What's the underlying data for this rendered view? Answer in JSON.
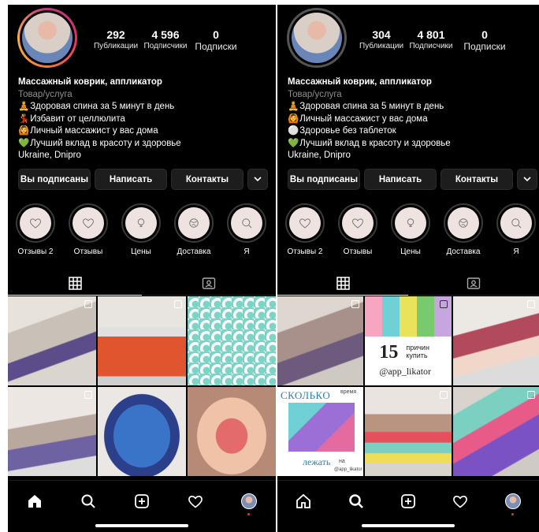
{
  "screens": [
    {
      "stats": [
        {
          "value": "292",
          "label": "Публикации"
        },
        {
          "value": "4 596",
          "label": "Подписчики"
        },
        {
          "value": "0",
          "label": "Подписки"
        }
      ],
      "bio": {
        "name": "Массажный коврик, аппликатор",
        "category": "Товар/услуга",
        "lines": [
          {
            "emoji": "🧘",
            "text": "Здоровая спина за 5 минут в день"
          },
          {
            "emoji": "💃",
            "text": "Избавит от целлюлита"
          },
          {
            "emoji": "🙆",
            "text": "Личный массажист у вас дома"
          },
          {
            "emoji": "💚",
            "text": "Лучший вклад в красоту и здоровье"
          }
        ],
        "location": "Ukraine, Dnipro"
      },
      "buttons": {
        "following": "Вы подписаны",
        "message": "Написать",
        "contacts": "Контакты"
      },
      "highlights": [
        "Отзывы 2",
        "Отзывы",
        "Цены",
        "Доставка",
        "Я"
      ]
    },
    {
      "stats": [
        {
          "value": "304",
          "label": "Публикации"
        },
        {
          "value": "4 801",
          "label": "Подписчики"
        },
        {
          "value": "0",
          "label": "Подписки"
        }
      ],
      "bio": {
        "name": "Массажный коврик, аппликатор",
        "category": "Товар/услуга",
        "lines": [
          {
            "emoji": "🧘",
            "text": "Здоровая спина за 5 минут в день"
          },
          {
            "emoji": "🙆",
            "text": "Личный массажист у вас дома"
          },
          {
            "emoji": "⚪",
            "text": "Здоровье без таблеток"
          },
          {
            "emoji": "💚",
            "text": "Лучший вклад в красоту и здоровье"
          }
        ],
        "location": "Ukraine, Dnipro"
      },
      "buttons": {
        "following": "Вы подписаны",
        "message": "Написать",
        "contacts": "Контакты"
      },
      "highlights": [
        "Отзывы 2",
        "Отзывы",
        "Цены",
        "Доставка",
        "Я"
      ],
      "post_text": {
        "number": "15",
        "reasons": "причин купить",
        "handle": "@app_likator",
        "how_much": "СКОЛЬКО",
        "time": "время",
        "lie": "лежать",
        "on": "на",
        "handle_small": "@app_likator"
      }
    }
  ],
  "icons": {
    "dropdown": "chevron-down-icon",
    "grid_tab": "grid-icon",
    "tagged_tab": "tagged-icon",
    "nav": [
      "home-icon",
      "search-icon",
      "new-post-icon",
      "heart-icon",
      "profile-avatar"
    ]
  },
  "colors": {
    "background": "#000000",
    "text": "#ffffff",
    "secondary": "#8e8e8e",
    "button": "#1d1d1d",
    "story_ring": "#e1306c"
  }
}
